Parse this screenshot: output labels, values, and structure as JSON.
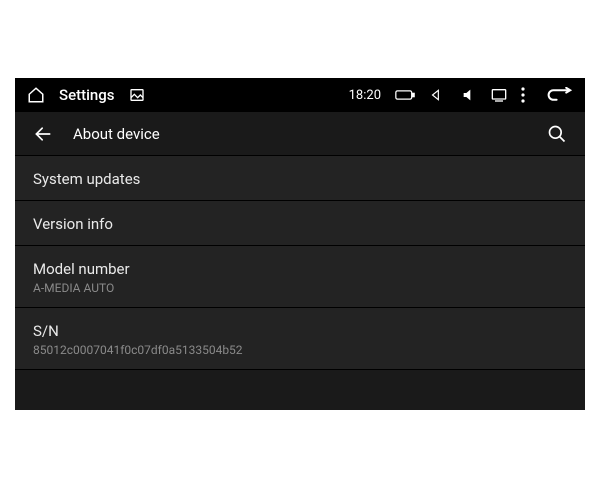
{
  "statusbar": {
    "app_label": "Settings",
    "time": "18:20"
  },
  "appbar": {
    "title": "About device"
  },
  "list": {
    "items": [
      {
        "title": "System updates",
        "sub": ""
      },
      {
        "title": "Version info",
        "sub": ""
      },
      {
        "title": "Model number",
        "sub": "A-MEDIA AUTO"
      },
      {
        "title": "S/N",
        "sub": "85012c0007041f0c07df0a5133504b52"
      }
    ]
  }
}
